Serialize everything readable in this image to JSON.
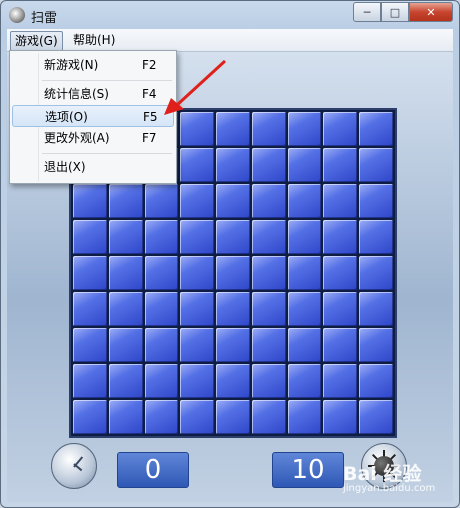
{
  "window": {
    "title": "扫雷"
  },
  "caption_buttons": {
    "minimize": "─",
    "maximize": "□",
    "close": "✕"
  },
  "menubar": {
    "game": "游戏(G)",
    "help": "帮助(H)"
  },
  "game_menu": {
    "items": [
      {
        "label": "新游戏(N)",
        "shortcut": "F2"
      },
      {
        "label": "统计信息(S)",
        "shortcut": "F4"
      },
      {
        "label": "选项(O)",
        "shortcut": "F5"
      },
      {
        "label": "更改外观(A)",
        "shortcut": "F7"
      },
      {
        "label": "退出(X)",
        "shortcut": ""
      }
    ],
    "highlighted": "选项(O)"
  },
  "status": {
    "time": "0",
    "mines_remaining": "10"
  },
  "board": {
    "rows": 9,
    "cols": 9
  },
  "annotation": {
    "arrow_color": "#e0201a"
  },
  "watermark": {
    "brand": "Bai 经验",
    "url": "jingyan.baidu.com"
  }
}
